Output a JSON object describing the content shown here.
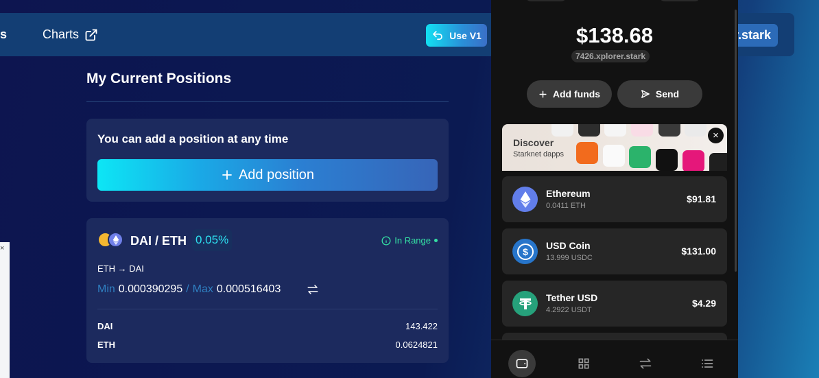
{
  "header": {
    "nav_fragment": "s",
    "charts_label": "Charts",
    "use_v1_label": "Use V1",
    "account_fragment": "r.stark"
  },
  "positions": {
    "title": "My Current Positions",
    "add_card": {
      "message": "You can add a position at any time",
      "button_label": "Add position"
    },
    "position": {
      "pair": "DAI / ETH",
      "fee": "0.05%",
      "status": "In Range",
      "direction": "ETH → DAI",
      "min_label": "Min",
      "min_value": "0.000390295",
      "separator": "/",
      "max_label": "Max",
      "max_value": "0.000516403",
      "tokens": [
        {
          "name": "DAI",
          "amount": "143.422"
        },
        {
          "name": "ETH",
          "amount": "0.0624821"
        }
      ]
    }
  },
  "wallet": {
    "balance": "$138.68",
    "handle": "7426.xplorer.stark",
    "add_funds_label": "Add funds",
    "send_label": "Send",
    "discover": {
      "title": "Discover",
      "subtitle": "Starknet dapps"
    },
    "tokens": [
      {
        "name": "Ethereum",
        "amount": "0.0411 ETH",
        "value": "$91.81",
        "icon": "ethereum-icon",
        "color": "#627eea"
      },
      {
        "name": "USD Coin",
        "amount": "13.999 USDC",
        "value": "$131.00",
        "icon": "usdc-icon",
        "color": "#2775ca"
      },
      {
        "name": "Tether USD",
        "amount": "4.2922 USDT",
        "value": "$4.29",
        "icon": "tether-icon",
        "color": "#26a17b"
      }
    ],
    "bottom_nav": [
      "wallet-icon",
      "grid-icon",
      "swap-icon",
      "list-icon"
    ]
  },
  "colors": {
    "accent_cyan": "#2de0f0",
    "in_range_green": "#35e0a4",
    "wallet_bg": "#121212"
  }
}
